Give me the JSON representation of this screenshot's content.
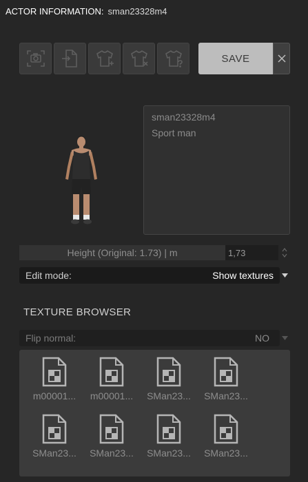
{
  "header": {
    "label": "ACTOR INFORMATION:",
    "actor_id": "sman23328m4"
  },
  "toolbar": {
    "buttons": [
      {
        "icon": "camera-icon"
      },
      {
        "icon": "import-file-icon"
      },
      {
        "icon": "add-shirt-icon"
      },
      {
        "icon": "remove-shirt-icon"
      },
      {
        "icon": "shirt-help-icon"
      }
    ],
    "save_label": "SAVE"
  },
  "info": {
    "name": "sman23328m4",
    "description": "Sport man"
  },
  "height": {
    "label": "Height (Original: 1.73) | m",
    "value": "1,73"
  },
  "edit_mode": {
    "label": "Edit mode:",
    "value": "Show textures"
  },
  "texture_browser": {
    "title": "TEXTURE BROWSER",
    "flip_normal": {
      "label": "Flip normal:",
      "value": "NO"
    },
    "items": [
      {
        "name": "m00001..."
      },
      {
        "name": "m00001..."
      },
      {
        "name": "SMan23..."
      },
      {
        "name": "SMan23..."
      },
      {
        "name": "SMan23..."
      },
      {
        "name": "SMan23..."
      },
      {
        "name": "SMan23..."
      },
      {
        "name": "SMan23..."
      }
    ]
  },
  "colors": {
    "background": "#262626",
    "save_button": "#bdbdbd",
    "panel": "#3b3b3b"
  }
}
